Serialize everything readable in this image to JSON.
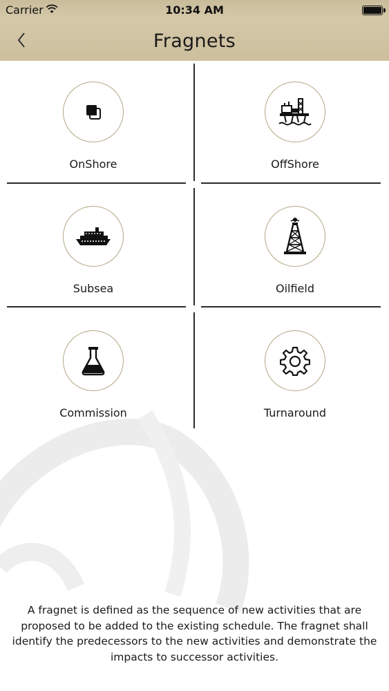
{
  "status_bar": {
    "carrier": "Carrier",
    "time": "10:34 AM"
  },
  "nav": {
    "title": "Fragnets"
  },
  "tiles": [
    {
      "label": "OnShore",
      "icon": "onshore-icon"
    },
    {
      "label": "OffShore",
      "icon": "offshore-rig-icon"
    },
    {
      "label": "Subsea",
      "icon": "ship-icon"
    },
    {
      "label": "Oilfield",
      "icon": "oil-derrick-icon"
    },
    {
      "label": "Commission",
      "icon": "flask-icon"
    },
    {
      "label": "Turnaround",
      "icon": "gear-icon"
    }
  ],
  "description": "A fragnet is defined as the sequence of new activities that are proposed to be added to the existing schedule. The fragnet shall identify the predecessors to the new activities and demonstrate the impacts to successor activities.",
  "colors": {
    "header": "#cdbf9d",
    "circle_border": "#b3a685",
    "divider": "#2a2a2a"
  }
}
